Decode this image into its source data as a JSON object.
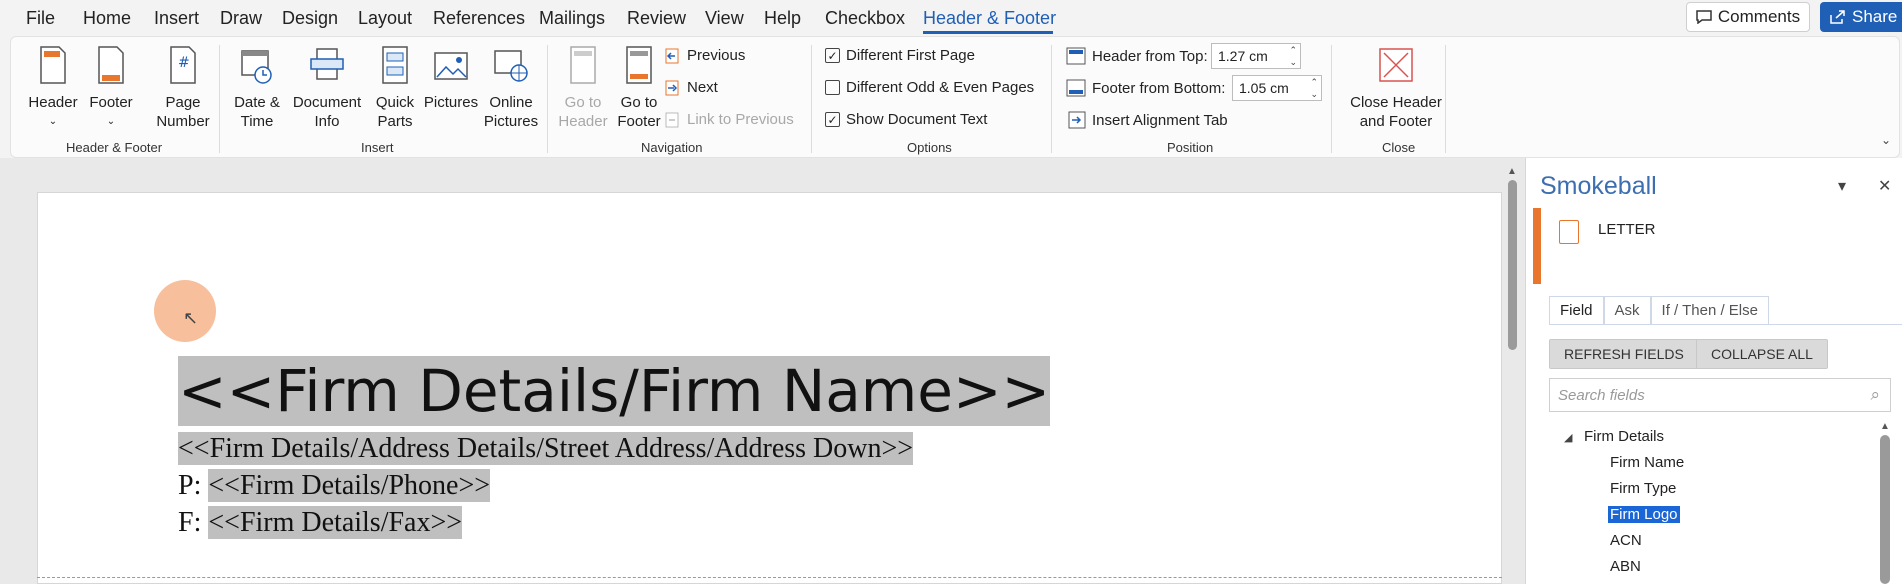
{
  "menu": {
    "tabs": [
      "File",
      "Home",
      "Insert",
      "Draw",
      "Design",
      "Layout",
      "References",
      "Mailings",
      "Review",
      "View",
      "Help",
      "Checkbox",
      "Header & Footer"
    ],
    "comments_label": "Comments",
    "share_label": "Share"
  },
  "ribbon": {
    "header_footer": {
      "header": "Header",
      "footer": "Footer",
      "page": "Page",
      "number": "Number",
      "group": "Header & Footer"
    },
    "insert": {
      "date1": "Date &",
      "date2": "Time",
      "doc1": "Document",
      "doc2": "Info",
      "quick1": "Quick",
      "quick2": "Parts",
      "pictures": "Pictures",
      "online1": "Online",
      "online2": "Pictures",
      "group": "Insert"
    },
    "navigation": {
      "goto_header1": "Go to",
      "goto_header2": "Header",
      "goto_footer1": "Go to",
      "goto_footer2": "Footer",
      "previous": "Previous",
      "next": "Next",
      "link_previous": "Link to Previous",
      "group": "Navigation"
    },
    "options": {
      "diff_first": "Different First Page",
      "diff_odd_even": "Different Odd & Even Pages",
      "show_doc_text": "Show Document Text",
      "group": "Options"
    },
    "position": {
      "header_top_label": "Header from Top:",
      "header_top_value": "1.27 cm",
      "footer_bottom_label": "Footer from Bottom:",
      "footer_bottom_value": "1.05 cm",
      "align_tab": "Insert Alignment Tab",
      "group": "Position"
    },
    "close": {
      "label1": "Close Header",
      "label2": "and Footer",
      "group": "Close"
    }
  },
  "document": {
    "firm_name": "<<Firm Details/Firm Name>>",
    "address": "<<Firm Details/Address Details/Street Address/Address Down>>",
    "phone_prefix": "P: ",
    "phone": "<<Firm Details/Phone>>",
    "fax_prefix": "F: ",
    "fax": "<<Firm Details/Fax>>"
  },
  "pane": {
    "title": "Smokeball",
    "template_name": "LETTER",
    "tabs": [
      "Field",
      "Ask",
      "If / Then / Else"
    ],
    "refresh_label": "REFRESH FIELDS",
    "collapse_label": "COLLAPSE ALL",
    "search_placeholder": "Search fields",
    "tree_root": "Firm Details",
    "tree_children": [
      "Firm Name",
      "Firm Type",
      "Firm Logo",
      "ACN",
      "ABN"
    ]
  }
}
